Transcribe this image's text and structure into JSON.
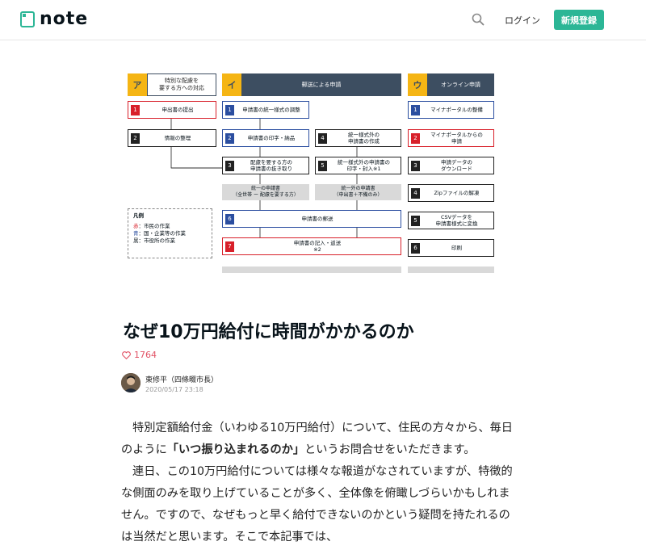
{
  "header": {
    "logo_text": "note",
    "login_label": "ログイン",
    "signup_label": "新規登録"
  },
  "figure": {
    "columns": [
      {
        "tag": "ア",
        "title": "特別な配慮を\n要する方への対応"
      },
      {
        "tag": "イ",
        "title": "郵送による申請"
      },
      {
        "tag": "ウ",
        "title": "オンライン申請"
      }
    ],
    "col_a": [
      {
        "num": "1",
        "text": "申出書の提出"
      },
      {
        "num": "2",
        "text": "情報の整理"
      }
    ],
    "col_b_left": [
      {
        "num": "1",
        "text": "申請書の統一様式の調整"
      },
      {
        "num": "2",
        "text": "申請書の印字・納品"
      },
      {
        "num": "3",
        "text": "配慮を要する方の\n申請書の抜き取り"
      }
    ],
    "col_b_right": [
      {
        "num": "4",
        "text": "統一様式外の\n申請書の作成"
      },
      {
        "num": "5",
        "text": "統一様式外の申請書の\n印字・封入※1"
      }
    ],
    "grey_left": "統一の申請書\n（全世帯 ー 配慮を要する方）",
    "grey_right": "統一外の申請書\n（申出書＋不備のみ）",
    "col_b_merge": [
      {
        "num": "6",
        "text": "申請書の郵送"
      },
      {
        "num": "7",
        "text": "申請書の記入・返送\n※2"
      }
    ],
    "col_c": [
      {
        "num": "1",
        "text": "マイナポータルの整備"
      },
      {
        "num": "2",
        "text": "マイナポータルからの\n申請"
      },
      {
        "num": "3",
        "text": "申請データの\nダウンロード"
      },
      {
        "num": "4",
        "text": "Zipファイルの解凍"
      },
      {
        "num": "5",
        "text": "CSVデータを\n申請書様式に変換"
      },
      {
        "num": "6",
        "text": "印刷"
      }
    ],
    "legend": {
      "title": "凡例",
      "red_key": "赤",
      "red_text": "：市民の作業",
      "blue_key": "青",
      "blue_text": "：国・企業等の作業",
      "black_key": "黒",
      "black_text": "：市役所の作業"
    }
  },
  "article": {
    "title": "なぜ10万円給付に時間がかかるのか",
    "likes": "1764",
    "author": "東修平（四條畷市長）",
    "date": "2020/05/17 23:18",
    "p1_a": "特別定額給付金（いわゆる10万円給付）について、住民の方々から、毎日のように",
    "p1_bold": "「いつ振り込まれるのか」",
    "p1_b": "というお問合せをいただきます。",
    "p2": "連日、この10万円給付については様々な報道がなされていますが、特徴的な側面のみを取り上げていることが多く、全体像を俯瞰しづらいかもしれません。ですので、なぜもっと早く給付できないのかという疑問を持たれるのは当然だと思います。そこで本記事では、"
  },
  "colors": {
    "accent": "#2cb696",
    "heart": "#e15164",
    "header_bar": "#3d4e61",
    "tag_yellow": "#f5b514",
    "red": "#d8202a",
    "blue": "#2b4ea0"
  }
}
